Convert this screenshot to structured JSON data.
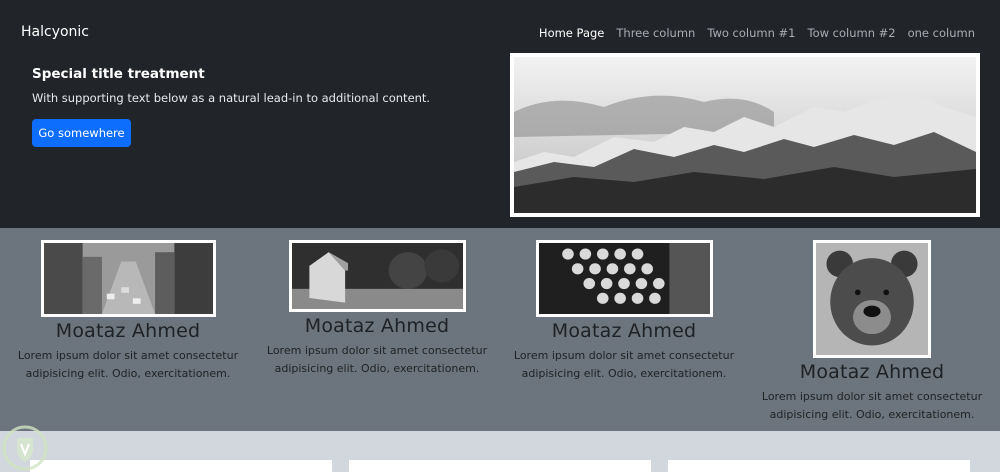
{
  "navbar": {
    "brand": "Halcyonic",
    "links": [
      {
        "label": "Home Page",
        "active": true
      },
      {
        "label": "Three column",
        "active": false
      },
      {
        "label": "Two column #1",
        "active": false
      },
      {
        "label": "Tow column #2",
        "active": false
      },
      {
        "label": "one column",
        "active": false
      }
    ]
  },
  "hero": {
    "title": "Special title treatment",
    "text": "With supporting text below as a natural lead-in to additional content.",
    "button_label": "Go somewhere",
    "image": "mountain-landscape-photo"
  },
  "cards": [
    {
      "title": "Moataz Ahmed",
      "text": "Lorem ipsum dolor sit amet consectetur adipisicing elit. Odio, exercitationem.",
      "image": "city-street-photo"
    },
    {
      "title": "Moataz Ahmed",
      "text": "Lorem ipsum dolor sit amet consectetur adipisicing elit. Odio, exercitationem.",
      "image": "wooden-shed-photo"
    },
    {
      "title": "Moataz Ahmed",
      "text": "Lorem ipsum dolor sit amet consectetur adipisicing elit. Odio, exercitationem.",
      "image": "typewriter-photo"
    },
    {
      "title": "Moataz Ahmed",
      "text": "Lorem ipsum dolor sit amet consectetur adipisicing elit. Odio, exercitationem.",
      "image": "bear-photo"
    }
  ],
  "colors": {
    "header_bg": "#212429",
    "band_bg": "#6c757d",
    "page_bg": "#d2d6dd",
    "primary_button": "#0d6efd"
  }
}
